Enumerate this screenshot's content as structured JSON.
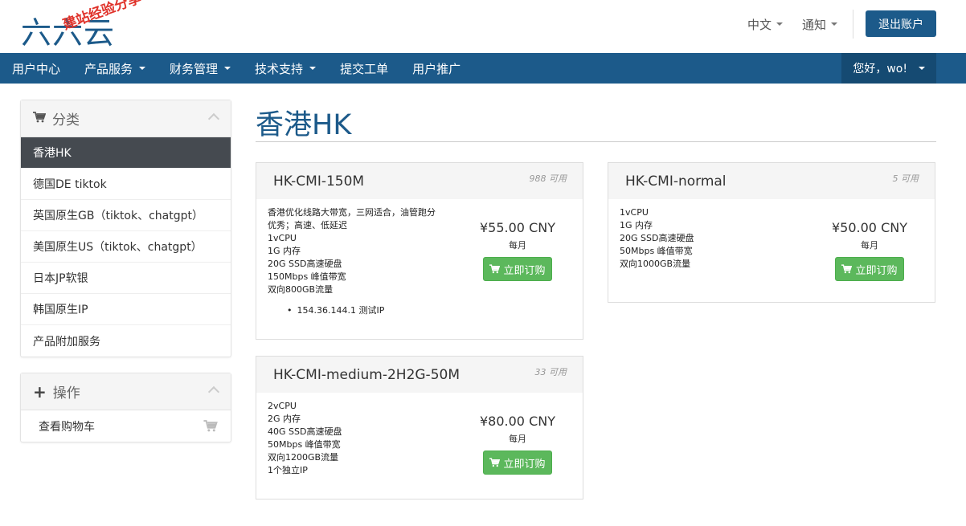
{
  "header": {
    "logo": "六六云",
    "watermark": "建站经验分享-www.w",
    "language": "中文",
    "notifications": "通知",
    "logout": "退出账户"
  },
  "nav": {
    "items": [
      {
        "label": "用户中心",
        "dropdown": false
      },
      {
        "label": "产品服务",
        "dropdown": true
      },
      {
        "label": "财务管理",
        "dropdown": true
      },
      {
        "label": "技术支持",
        "dropdown": true
      },
      {
        "label": "提交工单",
        "dropdown": false
      },
      {
        "label": "用户推广",
        "dropdown": false
      }
    ],
    "greeting": "您好，wo!"
  },
  "sidebar": {
    "categories_title": "分类",
    "categories": [
      "香港HK",
      "德国DE tiktok",
      "英国原生GB（tiktok、chatgpt）",
      "美国原生US（tiktok、chatgpt）",
      "日本JP软银",
      "韩国原生IP",
      "产品附加服务"
    ],
    "active_index": 0,
    "actions_title": "操作",
    "actions": [
      "查看购物车"
    ]
  },
  "main": {
    "title": "香港HK",
    "products": [
      {
        "name": "HK-CMI-150M",
        "available": "988 可用",
        "lines": [
          "香港优化线路大带宽，三网适合，油管跑分",
          "优秀；高速、低延迟",
          "1vCPU",
          "1G 内存",
          "20G SSD高速硬盘",
          "150Mbps 峰值带宽",
          "双向800GB流量"
        ],
        "bullet": "154.36.144.1 测试IP",
        "price": "¥55.00 CNY",
        "cycle": "每月",
        "order": "立即订购"
      },
      {
        "name": "HK-CMI-normal",
        "available": "5 可用",
        "lines": [
          "1vCPU",
          "1G 内存",
          "20G SSD高速硬盘",
          "50Mbps 峰值带宽",
          "双向1000GB流量"
        ],
        "price": "¥50.00 CNY",
        "cycle": "每月",
        "order": "立即订购"
      },
      {
        "name": "HK-CMI-medium-2H2G-50M",
        "available": "33 可用",
        "lines": [
          "2vCPU",
          "2G 内存",
          "40G SSD高速硬盘",
          "50Mbps 峰值带宽",
          "双向1200GB流量",
          "1个独立IP"
        ],
        "price": "¥80.00 CNY",
        "cycle": "每月",
        "order": "立即订购"
      }
    ]
  }
}
